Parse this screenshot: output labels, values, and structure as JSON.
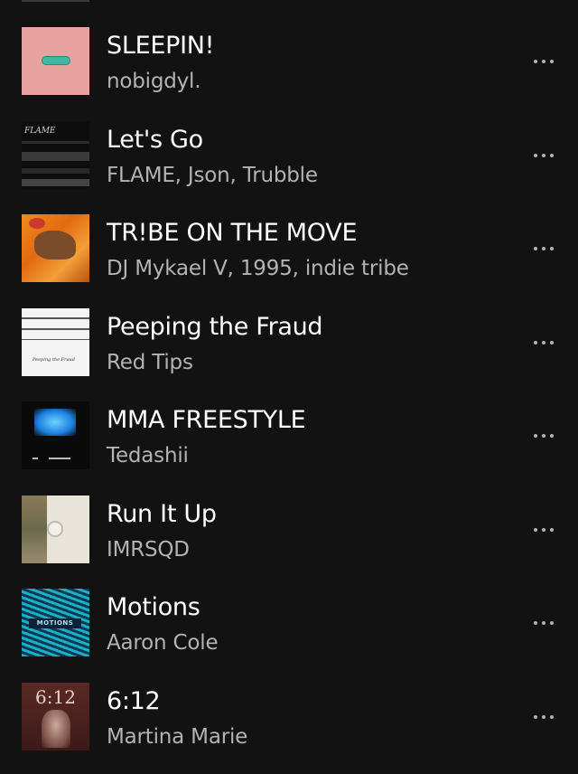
{
  "tracks": [
    {
      "title": "SLEEPIN!",
      "artist": "nobigdyl.",
      "art": "pink-pill-cover"
    },
    {
      "title": "Let's Go",
      "artist": "FLAME, Json, Trubble",
      "art": "dark-flame-cover",
      "art_text": "FLAME"
    },
    {
      "title": "TR!BE ON THE MOVE",
      "artist": "DJ Mykael V, 1995, indie tribe",
      "art": "orange-horse-cover"
    },
    {
      "title": "Peeping the Fraud",
      "artist": "Red Tips",
      "art": "barbed-wire-cover",
      "art_text": "Peeping the Fraud"
    },
    {
      "title": "MMA FREESTYLE",
      "artist": "Tedashii",
      "art": "blue-sky-cover"
    },
    {
      "title": "Run It Up",
      "artist": "IMRSQD",
      "art": "beige-collage-cover"
    },
    {
      "title": "Motions",
      "artist": "Aaron Cole",
      "art": "cyan-waves-cover",
      "art_text": "MOTIONS"
    },
    {
      "title": "6:12",
      "artist": "Martina Marie",
      "art": "maroon-statue-cover",
      "art_text": "6:12"
    }
  ],
  "more_icon": "more-horizontal-icon",
  "colors": {
    "background": "#121212",
    "title": "#ffffff",
    "subtitle": "#b3b3b3"
  }
}
